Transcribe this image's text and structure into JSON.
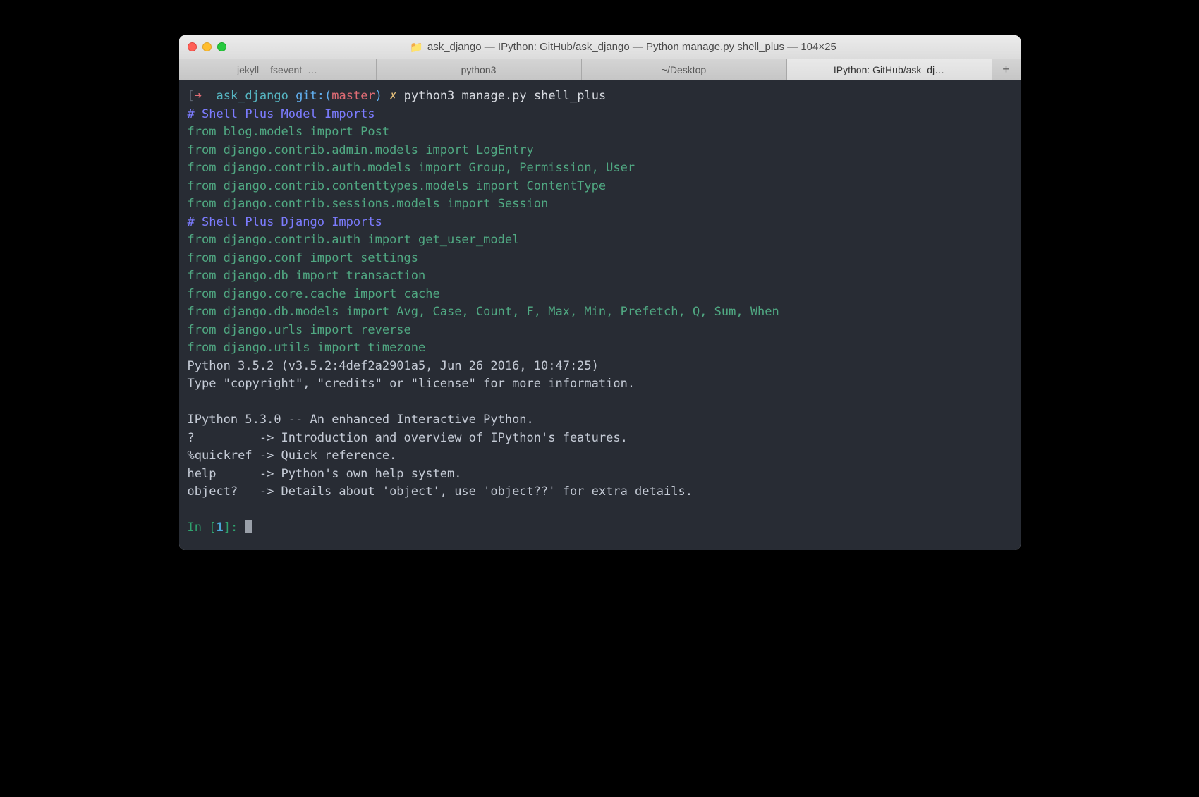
{
  "window": {
    "title": "ask_django — IPython: GitHub/ask_django — Python manage.py shell_plus — 104×25"
  },
  "tabs": {
    "group1a": "jekyll",
    "group1b": "fsevent_…",
    "t2": "python3",
    "t3": "~/Desktop",
    "t4": "IPython: GitHub/ask_dj…",
    "plus": "+"
  },
  "prompt": {
    "bracket_open": "[",
    "arrow": "➜ ",
    "dir": " ask_django",
    "git_label": " git:(",
    "branch": "master",
    "git_close": ")",
    "dirty": " ✗",
    "command": " python3 manage.py shell_plus",
    "bracket_close": "]"
  },
  "lines": {
    "c1": "# Shell Plus Model Imports",
    "g1": "from blog.models import Post",
    "g2": "from django.contrib.admin.models import LogEntry",
    "g3": "from django.contrib.auth.models import Group, Permission, User",
    "g4": "from django.contrib.contenttypes.models import ContentType",
    "g5": "from django.contrib.sessions.models import Session",
    "c2": "# Shell Plus Django Imports",
    "g6": "from django.contrib.auth import get_user_model",
    "g7": "from django.conf import settings",
    "g8": "from django.db import transaction",
    "g9": "from django.core.cache import cache",
    "g10": "from django.db.models import Avg, Case, Count, F, Max, Min, Prefetch, Q, Sum, When",
    "g11": "from django.urls import reverse",
    "g12": "from django.utils import timezone",
    "p1": "Python 3.5.2 (v3.5.2:4def2a2901a5, Jun 26 2016, 10:47:25)",
    "p2": "Type \"copyright\", \"credits\" or \"license\" for more information.",
    "p3": "",
    "p4": "IPython 5.3.0 -- An enhanced Interactive Python.",
    "p5": "?         -> Introduction and overview of IPython's features.",
    "p6": "%quickref -> Quick reference.",
    "p7": "help      -> Python's own help system.",
    "p8": "object?   -> Details about 'object', use 'object??' for extra details.",
    "p9": ""
  },
  "ipy": {
    "in": "In [",
    "num": "1",
    "close": "]: "
  }
}
